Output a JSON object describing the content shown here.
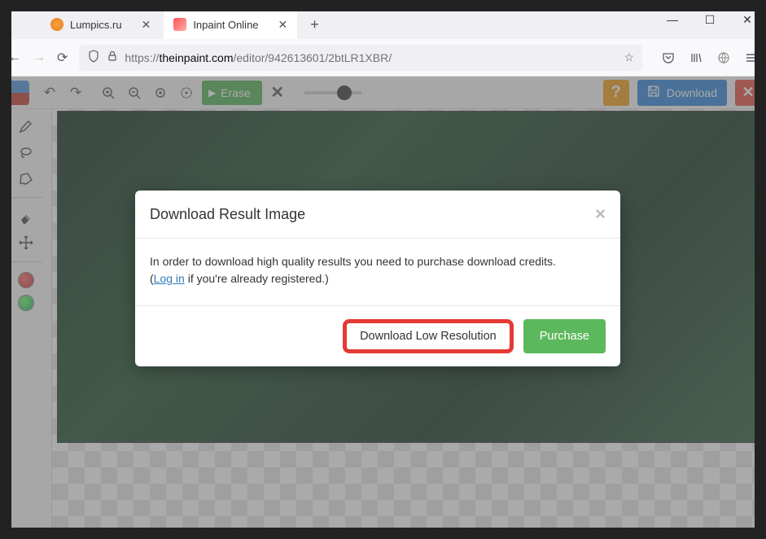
{
  "browser": {
    "tabs": [
      {
        "label": "Lumpics.ru"
      },
      {
        "label": "Inpaint Online"
      }
    ],
    "url_host": "theinpaint.com",
    "url_prefix": "https://",
    "url_path": "/editor/942613601/2btLR1XBR/"
  },
  "toolbar": {
    "erase_label": "Erase",
    "download_label": "Download"
  },
  "modal": {
    "title": "Download Result Image",
    "body_text": "In order to download high quality results you need to purchase download credits.",
    "login_prefix": "(",
    "login_link": "Log in",
    "login_suffix": " if you're already registered.)",
    "low_res_label": "Download Low Resolution",
    "purchase_label": "Purchase"
  }
}
